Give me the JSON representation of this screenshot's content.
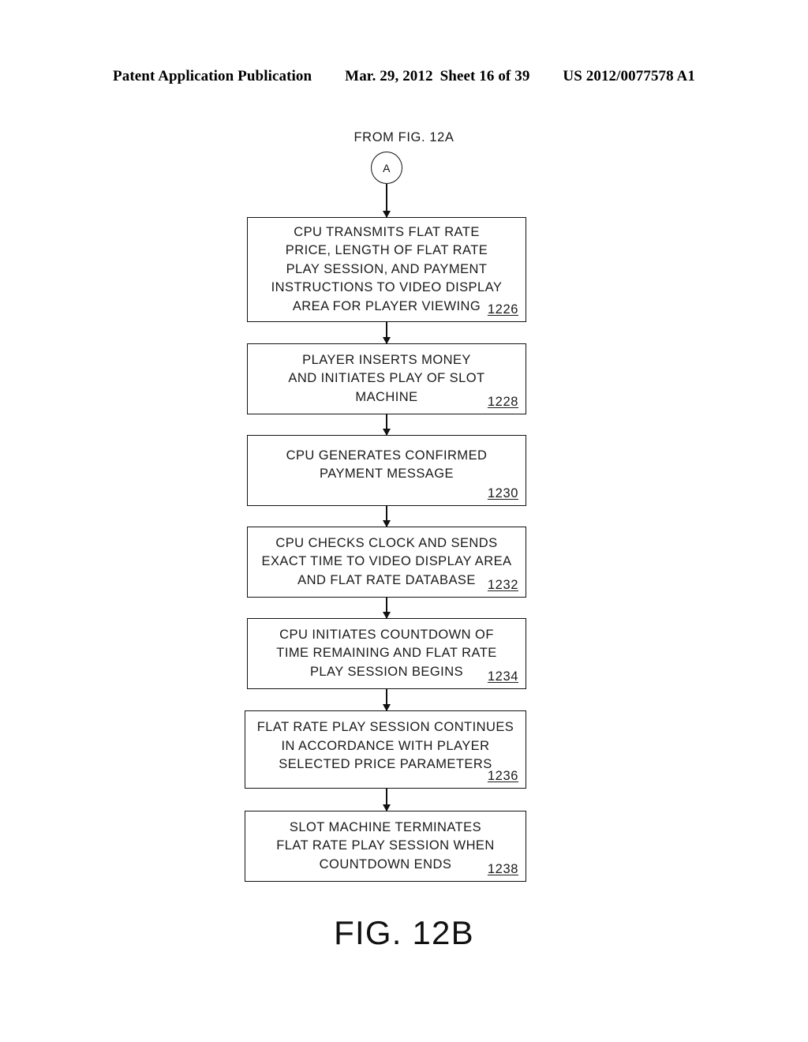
{
  "header": {
    "publication": "Patent Application Publication",
    "date": "Mar. 29, 2012",
    "sheet": "Sheet 16 of 39",
    "patent_number": "US 2012/0077578 A1"
  },
  "figure": {
    "caption": "FIG. 12B",
    "entry_label": "FROM FIG. 12A",
    "connector_letter": "A"
  },
  "chart_data": {
    "type": "diagram",
    "diagram_type": "flowchart",
    "orientation": "vertical",
    "title": "FIG. 12B",
    "entry_point": {
      "label": "FROM FIG. 12A",
      "connector": "A"
    },
    "nodes": [
      {
        "id": "1226",
        "shape": "rectangle",
        "text": "CPU TRANSMITS FLAT RATE\nPRICE, LENGTH OF FLAT RATE\nPLAY SESSION, AND PAYMENT\nINSTRUCTIONS TO VIDEO DISPLAY\nAREA FOR PLAYER VIEWING",
        "ref": "1226"
      },
      {
        "id": "1228",
        "shape": "rectangle",
        "text": "PLAYER INSERTS MONEY\nAND INITIATES PLAY OF SLOT\nMACHINE",
        "ref": "1228"
      },
      {
        "id": "1230",
        "shape": "rectangle",
        "text": "CPU GENERATES CONFIRMED\nPAYMENT MESSAGE",
        "ref": "1230"
      },
      {
        "id": "1232",
        "shape": "rectangle",
        "text": "CPU CHECKS CLOCK AND SENDS\nEXACT TIME TO VIDEO DISPLAY AREA\nAND FLAT RATE DATABASE",
        "ref": "1232"
      },
      {
        "id": "1234",
        "shape": "rectangle",
        "text": "CPU INITIATES COUNTDOWN OF\nTIME REMAINING AND FLAT RATE\nPLAY SESSION BEGINS",
        "ref": "1234"
      },
      {
        "id": "1236",
        "shape": "rectangle",
        "text": "FLAT RATE PLAY SESSION CONTINUES\nIN ACCORDANCE WITH PLAYER\nSELECTED PRICE PARAMETERS",
        "ref": "1236"
      },
      {
        "id": "1238",
        "shape": "rectangle",
        "text": "SLOT MACHINE TERMINATES\nFLAT RATE PLAY SESSION WHEN\nCOUNTDOWN ENDS",
        "ref": "1238"
      }
    ],
    "edges": [
      {
        "from": "A",
        "to": "1226",
        "style": "arrow"
      },
      {
        "from": "1226",
        "to": "1228",
        "style": "arrow"
      },
      {
        "from": "1228",
        "to": "1230",
        "style": "arrow"
      },
      {
        "from": "1230",
        "to": "1232",
        "style": "arrow"
      },
      {
        "from": "1232",
        "to": "1234",
        "style": "arrow"
      },
      {
        "from": "1234",
        "to": "1236",
        "style": "arrow"
      },
      {
        "from": "1236",
        "to": "1238",
        "style": "arrow"
      }
    ],
    "colors": {
      "ink": "#111111",
      "background": "#ffffff"
    }
  }
}
